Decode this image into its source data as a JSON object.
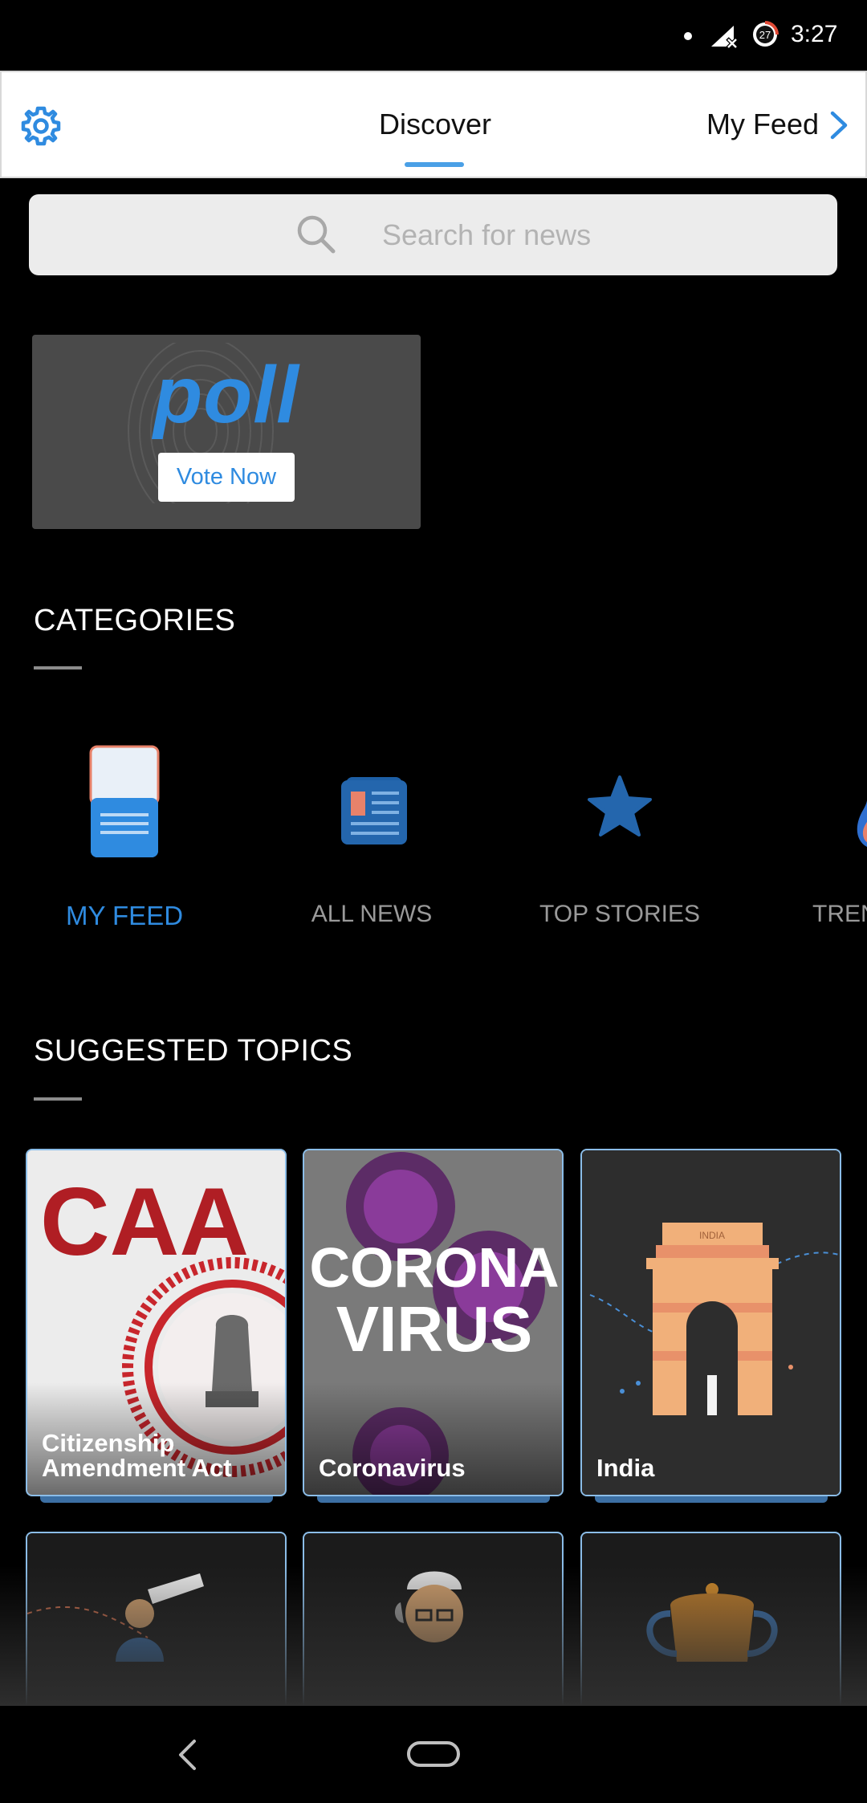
{
  "status_bar": {
    "time": "3:27",
    "badge_count": "27",
    "icons": [
      "notification-dot-icon",
      "signal-off-icon",
      "data-saver-icon"
    ]
  },
  "header": {
    "title": "Discover",
    "right_link": "My Feed",
    "accent_color": "#4aa0e6",
    "icons": [
      "gear-icon",
      "chevron-right-icon"
    ]
  },
  "search": {
    "placeholder": "Search for news",
    "icon": "search-icon"
  },
  "poll": {
    "word": "poll",
    "button_label": "Vote Now"
  },
  "categories": {
    "title": "CATEGORIES",
    "items": [
      {
        "label": "MY FEED",
        "icon": "my-feed-icon",
        "active": true
      },
      {
        "label": "ALL NEWS",
        "icon": "newspaper-icon",
        "active": false
      },
      {
        "label": "TOP STORIES",
        "icon": "star-icon",
        "active": false
      },
      {
        "label": "TREN",
        "icon": "flame-icon",
        "active": false
      }
    ]
  },
  "suggested_topics": {
    "title": "SUGGESTED TOPICS",
    "items": [
      {
        "label_line1": "Citizenship",
        "label_line2": "Amendment Act",
        "art_text": "CAA"
      },
      {
        "label_line1": "Coronavirus",
        "label_line2": "",
        "art_line1": "CORONA",
        "art_line2": "VIRUS"
      },
      {
        "label_line1": "India",
        "label_line2": "",
        "art_text": "INDIA"
      }
    ]
  },
  "nav_bar": {
    "icons": [
      "back-icon",
      "home-icon"
    ]
  },
  "colors": {
    "brand_blue": "#2f8be0",
    "background": "#000000",
    "topic_border": "#8bbde8"
  }
}
